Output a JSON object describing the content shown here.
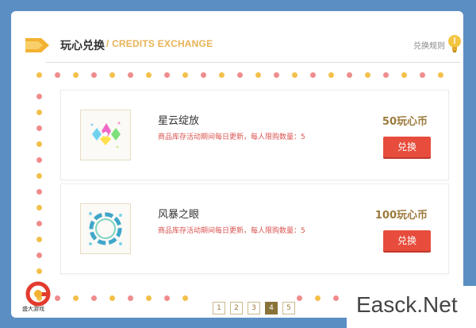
{
  "header": {
    "title": "玩心兑换",
    "subtitle": "/ CREDITS EXCHANGE",
    "rules_label": "兑换规则"
  },
  "items": [
    {
      "name": "星云绽放",
      "desc": "商品库存活动期间每日更新，每人限购数量：5",
      "price": "50玩心币",
      "button": "兑换"
    },
    {
      "name": "风暴之眼",
      "desc": "商品库存活动期间每日更新，每人限购数量：5",
      "price": "100玩心币",
      "button": "兑换"
    }
  ],
  "pagination": {
    "pages": [
      "1",
      "2",
      "3",
      "4",
      "5"
    ],
    "active": "4"
  },
  "logo_text": "盛大游戏",
  "watermark": "Easck.Net",
  "colors": {
    "background": "#5b8fc3",
    "button": "#e74c3c",
    "dot_pink": "#f08c8c",
    "dot_yellow": "#f3c04b",
    "price": "#9b7a3c"
  }
}
